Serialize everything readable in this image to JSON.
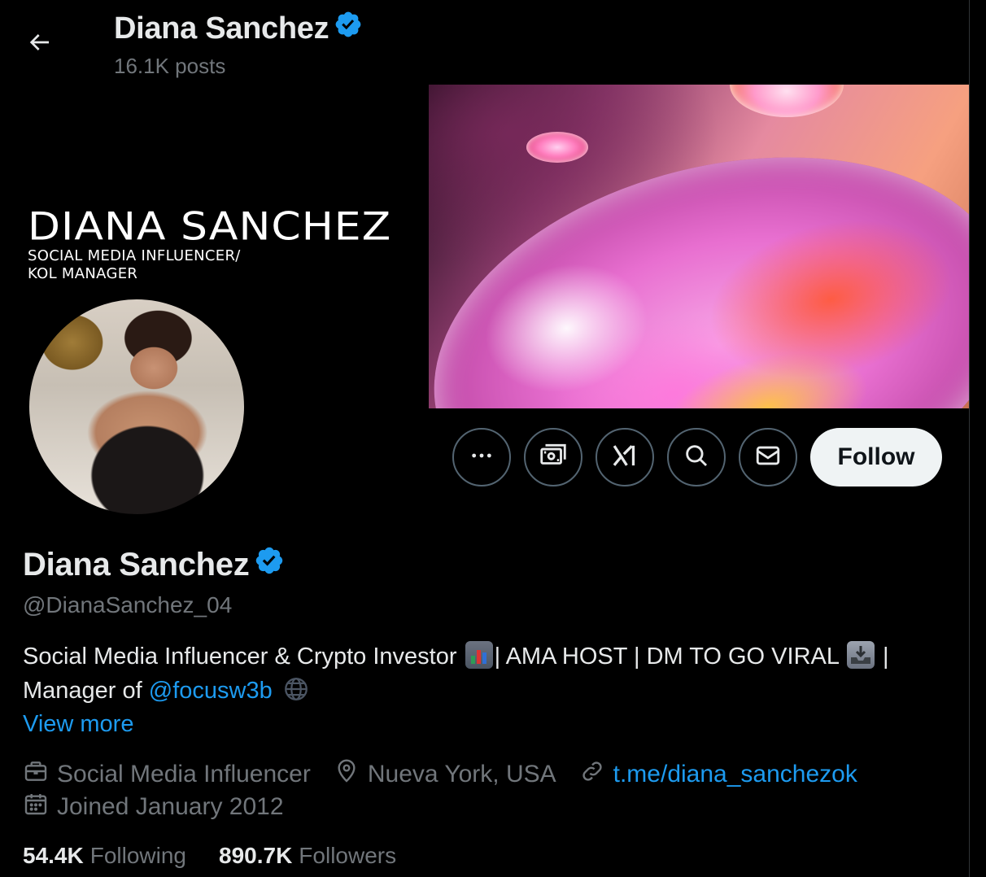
{
  "header": {
    "name": "Diana Sanchez",
    "posts": "16.1K posts"
  },
  "banner": {
    "title": "DIANA SANCHEZ",
    "subtitle_line1": "SOCIAL MEDIA INFLUENCER/",
    "subtitle_line2": "KOL MANAGER"
  },
  "actions": {
    "follow_label": "Follow"
  },
  "profile": {
    "name": "Diana Sanchez",
    "handle": "@DianaSanchez_04",
    "bio_part1": "Social Media Influencer & Crypto Investor ",
    "bio_part2": "| AMA HOST | DM TO GO VIRAL ",
    "bio_part3": " |",
    "bio_part4": "Manager of ",
    "bio_mention": "@focusw3b",
    "view_more": "View more",
    "profession": "Social Media Influencer",
    "location": "Nueva York, USA",
    "website": "t.me/diana_sanchezok",
    "joined": "Joined January 2012"
  },
  "stats": {
    "following_count": "54.4K",
    "following_label": "Following",
    "followers_count": "890.7K",
    "followers_label": "Followers"
  },
  "colors": {
    "verified": "#1d9bf0",
    "link": "#1d9bf0",
    "muted": "#71767b"
  }
}
